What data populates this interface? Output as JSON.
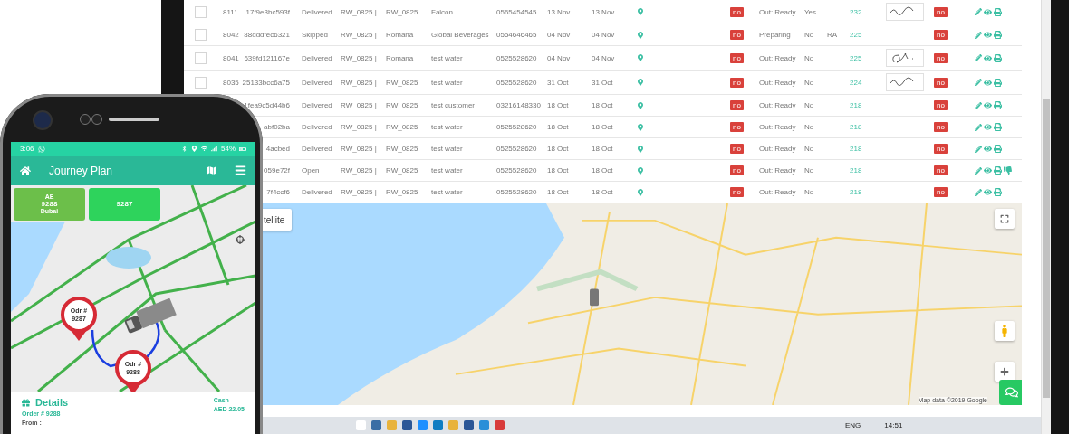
{
  "table": {
    "rows": [
      {
        "checked": false,
        "number": "8111",
        "id": "17f9e3bc593f",
        "status": "Delivered",
        "route": "RW_0825 |",
        "driver": "RW_0825",
        "customer": "Falcon",
        "phone": "0565454545",
        "date_1": "13 Nov",
        "date_2": "13 Nov",
        "badge": "no",
        "state": "Out: Ready",
        "paid": "Yes",
        "count": "232",
        "signature": true,
        "badge_2": "no",
        "flagged": false
      },
      {
        "checked": false,
        "number": "8042",
        "id": "88dddfec6321",
        "status": "Skipped",
        "route": "RW_0825 |",
        "driver": "Romana",
        "customer": "Global Beverages",
        "phone": "0554646465",
        "date_1": "04 Nov",
        "date_2": "04 Nov",
        "badge": "no",
        "state": "Preparing",
        "paid": "No",
        "extra": "RA",
        "count": "225",
        "signature": false,
        "badge_2": "no",
        "flagged": false
      },
      {
        "checked": false,
        "number": "8041",
        "id": "639fd121167e",
        "status": "Delivered",
        "route": "RW_0825 |",
        "driver": "Romana",
        "customer": "test water",
        "phone": "0525528620",
        "date_1": "04 Nov",
        "date_2": "04 Nov",
        "badge": "no",
        "state": "Out: Ready",
        "paid": "No",
        "count": "225",
        "signature": true,
        "badge_2": "no",
        "flagged": false
      },
      {
        "checked": false,
        "number": "8035",
        "id": "25133bcc6a75",
        "status": "Delivered",
        "route": "RW_0825 |",
        "driver": "RW_0825",
        "customer": "test water",
        "phone": "0525528620",
        "date_1": "31 Oct",
        "date_2": "31 Oct",
        "badge": "no",
        "state": "Out: Ready",
        "paid": "No",
        "count": "224",
        "signature": true,
        "badge_2": "no",
        "flagged": false
      },
      {
        "id": "1fea9c5d44b6",
        "status": "Delivered",
        "route": "RW_0825 |",
        "driver": "RW_0825",
        "customer": "test customer",
        "phone": "03216148330",
        "date_1": "18 Oct",
        "date_2": "18 Oct",
        "badge": "no",
        "state": "Out: Ready",
        "paid": "No",
        "count": "218",
        "signature": false,
        "badge_2": "no",
        "flagged": false
      },
      {
        "id": "abf02ba",
        "status": "Delivered",
        "route": "RW_0825 |",
        "driver": "RW_0825",
        "customer": "test water",
        "phone": "0525528620",
        "date_1": "18 Oct",
        "date_2": "18 Oct",
        "badge": "no",
        "state": "Out: Ready",
        "paid": "No",
        "count": "218",
        "signature": false,
        "badge_2": "no",
        "flagged": false
      },
      {
        "id": "4acbed",
        "status": "Delivered",
        "route": "RW_0825 |",
        "driver": "RW_0825",
        "customer": "test water",
        "phone": "0525528620",
        "date_1": "18 Oct",
        "date_2": "18 Oct",
        "badge": "no",
        "state": "Out: Ready",
        "paid": "No",
        "count": "218",
        "signature": false,
        "badge_2": "no",
        "flagged": false
      },
      {
        "id": "059e72f",
        "status": "Open",
        "route": "RW_0825 |",
        "driver": "RW_0825",
        "customer": "test water",
        "phone": "0525528620",
        "date_1": "18 Oct",
        "date_2": "18 Oct",
        "badge": "no",
        "state": "Out: Ready",
        "paid": "No",
        "count": "218",
        "signature": false,
        "badge_2": "no",
        "flagged": true
      },
      {
        "id": "7f4ccf6",
        "status": "Delivered",
        "route": "RW_0825 |",
        "driver": "RW_0825",
        "customer": "test water",
        "phone": "0525528620",
        "date_1": "18 Oct",
        "date_2": "18 Oct",
        "badge": "no",
        "state": "Out: Ready",
        "paid": "No",
        "count": "218",
        "signature": false,
        "badge_2": "no",
        "flagged": false
      }
    ]
  },
  "map": {
    "view_button": "tellite",
    "attribution": "Map data ©2019 Google"
  },
  "taskbar": {
    "language": "ENG",
    "time": "14:51"
  },
  "phone": {
    "status_bar": {
      "time": "3:06",
      "battery": "54%"
    },
    "app_bar": {
      "title": "Journey Plan"
    },
    "tiles": [
      {
        "lines": [
          "AE",
          "9288",
          "Dubai"
        ],
        "color": "#6cbf4a"
      },
      {
        "lines": [
          "9287"
        ],
        "color": "#2ed35c"
      }
    ],
    "markers": [
      {
        "label": "Odr #",
        "number": "9287"
      },
      {
        "label": "Odr #",
        "number": "9288"
      }
    ],
    "details": {
      "title": "Details",
      "order": "Order # 9288",
      "payment": "Cash",
      "amount": "AED 22.05",
      "from": "From :"
    }
  }
}
